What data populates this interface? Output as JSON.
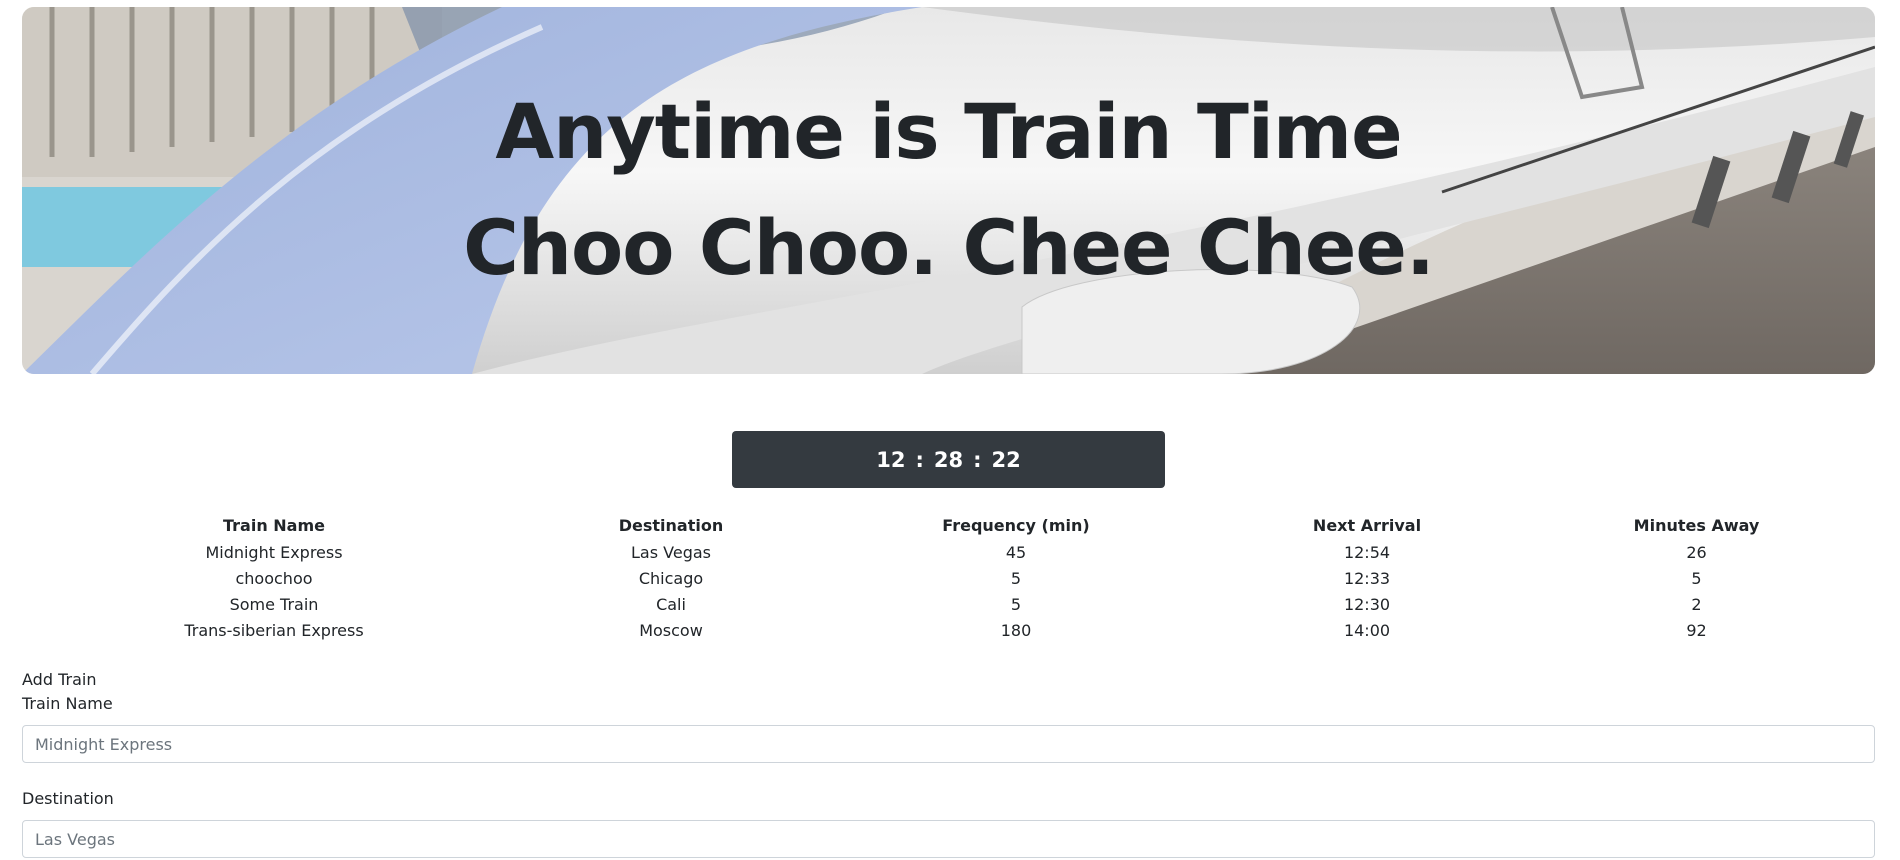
{
  "hero": {
    "line1": "Anytime is Train Time",
    "line2": "Choo Choo. Chee Chee."
  },
  "clock": {
    "hours": "12",
    "minutes": "28",
    "seconds": "22",
    "separator": ":"
  },
  "table": {
    "headers": [
      "Train Name",
      "Destination",
      "Frequency (min)",
      "Next Arrival",
      "Minutes Away"
    ],
    "rows": [
      [
        "Midnight Express",
        "Las Vegas",
        "45",
        "12:54",
        "26"
      ],
      [
        "choochoo",
        "Chicago",
        "5",
        "12:33",
        "5"
      ],
      [
        "Some Train",
        "Cali",
        "5",
        "12:30",
        "2"
      ],
      [
        "Trans-siberian Express",
        "Moscow",
        "180",
        "14:00",
        "92"
      ]
    ]
  },
  "form": {
    "title": "Add Train",
    "train_name_label": "Train Name",
    "train_name_placeholder": "Midnight Express",
    "destination_label": "Destination",
    "destination_placeholder": "Las Vegas"
  }
}
